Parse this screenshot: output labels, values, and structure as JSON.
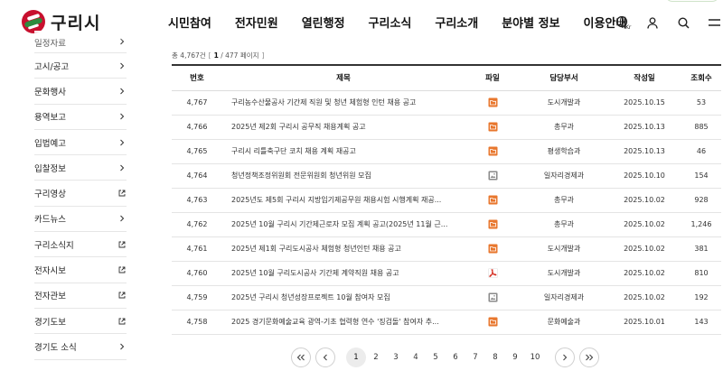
{
  "header": {
    "logo_text": "구리시",
    "nav": [
      "시민참여",
      "전자민원",
      "열린행정",
      "구리소식",
      "구리소개",
      "분야별 정보",
      "이용안내"
    ],
    "lang_badge": "Kr"
  },
  "sidebar": {
    "items": [
      {
        "label": "일정자료",
        "kind": "arrow"
      },
      {
        "label": "고시/공고",
        "kind": "arrow"
      },
      {
        "label": "문화행사",
        "kind": "arrow"
      },
      {
        "label": "용역보고",
        "kind": "arrow"
      },
      {
        "label": "입법예고",
        "kind": "arrow"
      },
      {
        "label": "입찰정보",
        "kind": "arrow"
      },
      {
        "label": "구리영상",
        "kind": "external"
      },
      {
        "label": "카드뉴스",
        "kind": "arrow"
      },
      {
        "label": "구리소식지",
        "kind": "external"
      },
      {
        "label": "전자시보",
        "kind": "external"
      },
      {
        "label": "전자관보",
        "kind": "external"
      },
      {
        "label": "경기도보",
        "kind": "external"
      },
      {
        "label": "경기도 소식",
        "kind": "arrow"
      }
    ]
  },
  "board": {
    "total_prefix": "총",
    "total_count": "4,767건",
    "current_page": "1",
    "total_pages": "/ 477 페이지",
    "columns": [
      "번호",
      "제목",
      "파일",
      "담당부서",
      "작성일",
      "조회수"
    ],
    "rows": [
      {
        "no": "4,767",
        "title": "구리농수산물공사 기간제 직원 및 청년 체험형 인턴 채용 공고",
        "file": "folder",
        "dept": "도시개발과",
        "date": "2025.10.15",
        "views": "53"
      },
      {
        "no": "4,766",
        "title": "2025년 제2회 구리시 공무직 채용계획 공고",
        "file": "folder",
        "dept": "총무과",
        "date": "2025.10.13",
        "views": "885"
      },
      {
        "no": "4,765",
        "title": "구리시 리틀축구단 코치 채용 계획 재공고",
        "file": "folder",
        "dept": "평생학습과",
        "date": "2025.10.13",
        "views": "46"
      },
      {
        "no": "4,764",
        "title": "청년정책조정위원회 전문위원회 청년위원 모집",
        "file": "image",
        "dept": "일자리경제과",
        "date": "2025.10.10",
        "views": "154"
      },
      {
        "no": "4,763",
        "title": "2025년도 제5회 구리시 지방임기제공무원 채용시험 시행계획 재공...",
        "file": "folder",
        "dept": "총무과",
        "date": "2025.10.02",
        "views": "928"
      },
      {
        "no": "4,762",
        "title": "2025년 10월 구리시 기간제근로자 모집 계획 공고(2025년 11월 근...",
        "file": "folder",
        "dept": "총무과",
        "date": "2025.10.02",
        "views": "1,246"
      },
      {
        "no": "4,761",
        "title": "2025년 제1회 구리도시공사 체험형 청년인턴 채용 공고",
        "file": "folder",
        "dept": "도시개발과",
        "date": "2025.10.02",
        "views": "381"
      },
      {
        "no": "4,760",
        "title": "2025년 10월 구리도시공사 기간제 계약직원 채용 공고",
        "file": "pdf",
        "dept": "도시개발과",
        "date": "2025.10.02",
        "views": "810"
      },
      {
        "no": "4,759",
        "title": "2025년 구리시 청년성장프로젝트 10월 참여자 모집",
        "file": "image",
        "dept": "일자리경제과",
        "date": "2025.10.02",
        "views": "192"
      },
      {
        "no": "4,758",
        "title": "2025 경기문화예술교육 광역-기초 협력형 연수 '징검돌' 참여자 추...",
        "file": "folder",
        "dept": "문화예술과",
        "date": "2025.10.01",
        "views": "143"
      }
    ]
  },
  "pagination": {
    "pages": [
      "1",
      "2",
      "3",
      "4",
      "5",
      "6",
      "7",
      "8",
      "9",
      "10"
    ],
    "active": "1"
  },
  "colors": {
    "folder_icon": "#e8772e",
    "pdf_icon": "#d42a1e",
    "image_icon": "#8a8a8a",
    "logo_red": "#c8102e",
    "logo_green": "#2e8b3e"
  }
}
